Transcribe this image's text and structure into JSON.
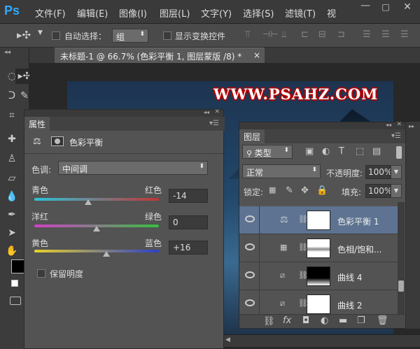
{
  "app": {
    "logo": "Ps"
  },
  "menu": [
    "文件(F)",
    "编辑(E)",
    "图像(I)",
    "图层(L)",
    "文字(Y)",
    "选择(S)",
    "滤镜(T)",
    "视"
  ],
  "options": {
    "auto_select_label": "自动选择：",
    "auto_select_value": "组",
    "show_transform_label": "显示变换控件"
  },
  "document": {
    "tab_title": "未标题-1 @ 66.7% (色彩平衡 1, 图层蒙版 /8) *",
    "close": "×",
    "watermark": "WWW.PSAHZ.COM"
  },
  "properties": {
    "tab": "属性",
    "header": "色彩平衡",
    "tone_label": "色调:",
    "tone_value": "中间调",
    "sliders": [
      {
        "left": "青色",
        "right": "红色",
        "value": "-14",
        "position": 0.43
      },
      {
        "left": "洋红",
        "right": "绿色",
        "value": "0",
        "position": 0.5
      },
      {
        "left": "黄色",
        "right": "蓝色",
        "value": "+16",
        "position": 0.58
      }
    ],
    "preserve_label": "保留明度"
  },
  "layers": {
    "tab": "图层",
    "filter_label": "类型",
    "blend_mode": "正常",
    "opacity_label": "不透明度:",
    "opacity_value": "100%",
    "lock_label": "锁定:",
    "fill_label": "填充:",
    "fill_value": "100%",
    "items": [
      {
        "name": "色彩平衡 1",
        "selected": true
      },
      {
        "name": "色相/饱和...",
        "selected": false
      },
      {
        "name": "曲线 4",
        "selected": false
      },
      {
        "name": "曲线 2",
        "selected": false
      }
    ]
  },
  "colors": {
    "accent": "#31a8ff",
    "selected_layer": "#5d7391"
  }
}
